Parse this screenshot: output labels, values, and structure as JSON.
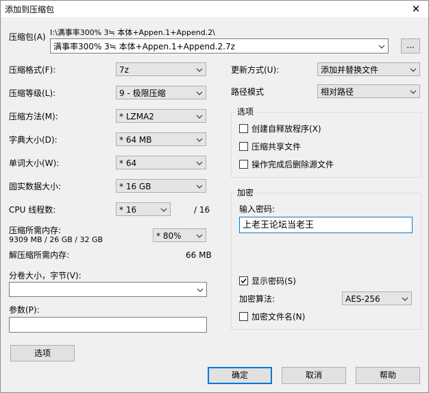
{
  "window": {
    "title": "添加到压缩包",
    "close": "✕"
  },
  "archive": {
    "label": "压缩包(A)",
    "path": "I:\\满事率300% 3≒ 本体+Appen.1+Append.2\\",
    "value": "满事率300% 3≒ 本体+Appen.1+Append.2.7z",
    "browse": "..."
  },
  "left": {
    "format_label": "压缩格式(F):",
    "format_value": "7z",
    "level_label": "压缩等级(L):",
    "level_value": "9 - 极限压缩",
    "method_label": "压缩方法(M):",
    "method_value": "*  LZMA2",
    "dict_label": "字典大小(D):",
    "dict_value": "*  64 MB",
    "word_label": "单词大小(W):",
    "word_value": "*  64",
    "solid_label": "固实数据大小:",
    "solid_value": "*  16 GB",
    "cpu_label": "CPU 线程数:",
    "cpu_value": "*  16",
    "cpu_max": "/ 16",
    "mem_label": "压缩所需内存:",
    "mem_detail": "9309 MB / 26 GB / 32 GB",
    "mem_value": "* 80%",
    "decomp_label": "解压缩所需内存:",
    "decomp_value": "66 MB",
    "split_label": "分卷大小，字节(V):",
    "split_value": "",
    "params_label": "参数(P):",
    "params_value": ""
  },
  "right": {
    "update_label": "更新方式(U):",
    "update_value": "添加并替换文件",
    "path_label": "路径模式",
    "path_value": "相对路径",
    "options_group": "选项",
    "opt_sfx": "创建自释放程序(X)",
    "opt_shared": "压缩共享文件",
    "opt_delete": "操作完成后删除源文件",
    "encrypt_group": "加密",
    "password_label": "输入密码:",
    "password_value": "上老王论坛当老王",
    "show_password": "显示密码(S)",
    "encrypt_method_label": "加密算法:",
    "encrypt_method_value": "AES-256",
    "encrypt_names": "加密文件名(N)"
  },
  "buttons": {
    "options": "选项",
    "ok": "确定",
    "cancel": "取消",
    "help": "帮助"
  },
  "checks": {
    "sfx": false,
    "shared": false,
    "delete": false,
    "show_password": true,
    "encrypt_names": false
  }
}
